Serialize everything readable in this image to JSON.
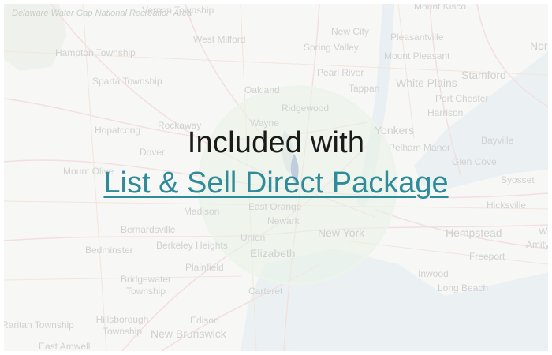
{
  "overlay": {
    "heading": "Included with",
    "link_label": "List & Sell Direct Package"
  },
  "map": {
    "labels": [
      "Delaware Water Gap National Recreation Area",
      "Vernon Township",
      "West Milford",
      "Hampton Township",
      "Sparta Township",
      "Hopatcong",
      "Rockaway",
      "Dover",
      "Mount Olive",
      "Wayne",
      "Oakland",
      "Ridgewood",
      "New City",
      "Spring Valley",
      "Pearl River",
      "Tappan",
      "Pleasantville",
      "Mount Pleasant",
      "White Plains",
      "Port Chester",
      "Harrison",
      "Stamford",
      "Mount Kisco",
      "Bayville",
      "Glen Cove",
      "Syosset",
      "Hicksville",
      "Hempstead",
      "Freeport",
      "Amity",
      "Long Beach",
      "Inwood",
      "Yonkers",
      "Pelham Manor",
      "East Orange",
      "Newark",
      "New York",
      "Madison",
      "Bernardsville",
      "Bedminster",
      "Berkeley Heights",
      "Union",
      "Elizabeth",
      "Plainfield",
      "Bridgewater Township",
      "Carteret",
      "Hillsborough Township",
      "Edison",
      "New Brunswick",
      "Raritan Township",
      "East Amwell",
      "Nor",
      "We"
    ]
  },
  "colors": {
    "link": "#2e8b9a",
    "heading": "#1a1a1a",
    "map_background": "#f3f3f1",
    "highlight_circle": "#dcedd9"
  }
}
